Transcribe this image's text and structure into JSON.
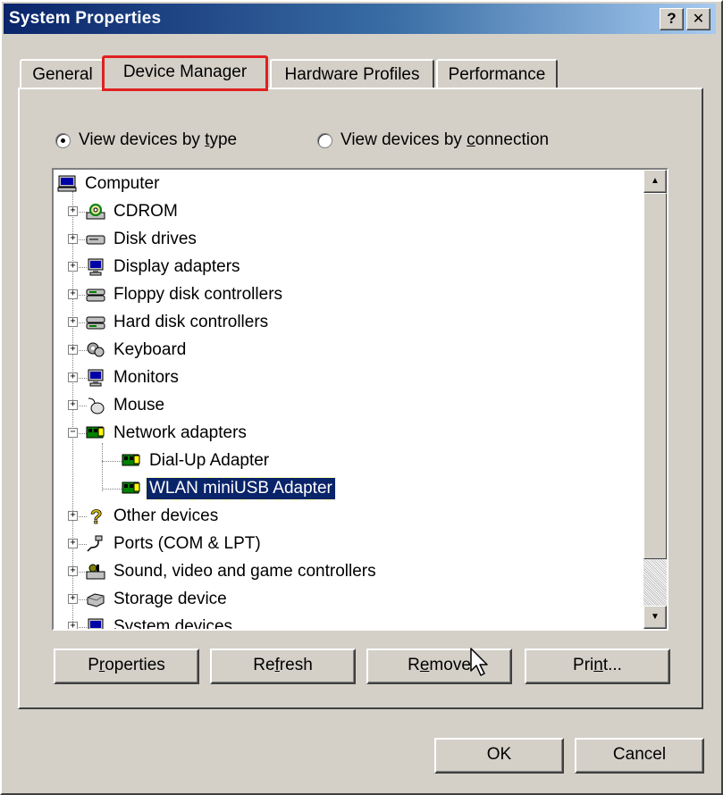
{
  "window": {
    "title": "System Properties",
    "help_label": "?",
    "close_label": "✕"
  },
  "tabs": [
    {
      "label": "General",
      "active": false
    },
    {
      "label": "Device Manager",
      "active": true
    },
    {
      "label": "Hardware Profiles",
      "active": false
    },
    {
      "label": "Performance",
      "active": false
    }
  ],
  "view": {
    "by_type_pre": "View devices by ",
    "by_type_key": "t",
    "by_type_post": "ype",
    "by_connection_pre": "View devices by ",
    "by_connection_key": "c",
    "by_connection_post": "onnection",
    "selected": "by_type"
  },
  "tree": {
    "root": "Computer",
    "items": [
      {
        "label": "CDROM",
        "icon": "cdrom-icon"
      },
      {
        "label": "Disk drives",
        "icon": "disk-drive-icon"
      },
      {
        "label": "Display adapters",
        "icon": "display-adapter-icon"
      },
      {
        "label": "Floppy disk controllers",
        "icon": "floppy-controller-icon"
      },
      {
        "label": "Hard disk controllers",
        "icon": "hard-disk-controller-icon"
      },
      {
        "label": "Keyboard",
        "icon": "keyboard-icon"
      },
      {
        "label": "Monitors",
        "icon": "monitor-icon"
      },
      {
        "label": "Mouse",
        "icon": "mouse-icon"
      },
      {
        "label": "Network adapters",
        "icon": "network-adapter-icon",
        "expanded": true
      },
      {
        "label": "Dial-Up Adapter",
        "icon": "network-card-icon",
        "child": true
      },
      {
        "label": "WLAN miniUSB Adapter",
        "icon": "network-card-icon",
        "child": true,
        "selected": true
      },
      {
        "label": "Other devices",
        "icon": "question-icon"
      },
      {
        "label": "Ports (COM & LPT)",
        "icon": "port-icon"
      },
      {
        "label": "Sound, video and game controllers",
        "icon": "sound-icon"
      },
      {
        "label": "Storage device",
        "icon": "storage-icon"
      },
      {
        "label": "System devices",
        "icon": "system-device-icon"
      }
    ]
  },
  "buttons": {
    "properties_pre": "P",
    "properties_key": "r",
    "properties_post": "operties",
    "refresh_pre": "Re",
    "refresh_key": "f",
    "refresh_post": "resh",
    "remove_pre": "R",
    "remove_key": "e",
    "remove_post": "move",
    "print_pre": "Pri",
    "print_key": "n",
    "print_post": "t...",
    "ok": "OK",
    "cancel": "Cancel"
  },
  "colors": {
    "title_start": "#0a246a",
    "selection": "#0a246a",
    "tab_highlight": "#e02020",
    "face": "#d4d0c8"
  }
}
